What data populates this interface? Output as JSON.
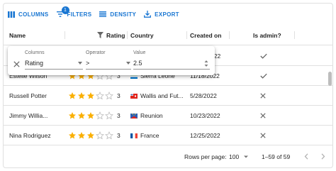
{
  "toolbar": {
    "columns_label": "COLUMNS",
    "filters_label": "FILTERS",
    "filters_badge": "1",
    "density_label": "DENSITY",
    "export_label": "EXPORT"
  },
  "columns": {
    "name": "Name",
    "rating": "Rating",
    "country": "Country",
    "created_on": "Created on",
    "is_admin": "Is admin?"
  },
  "filter": {
    "columns_label": "Columns",
    "columns_value": "Rating",
    "operator_label": "Operator",
    "operator_value": ">",
    "value_label": "Value",
    "value_value": "2.5",
    "partial_date": "022"
  },
  "rows": [
    {
      "name": "Estelle Wilson",
      "rating": 3,
      "rating_label": "3",
      "country": "Sierra Leone",
      "created": "11/18/2022",
      "admin": "false"
    },
    {
      "name": "Russell Potter",
      "rating": 3,
      "rating_label": "3",
      "country": "Wallis and Fut...",
      "created": "5/28/2022",
      "admin": "false"
    },
    {
      "name": "Jimmy Willia...",
      "rating": 3,
      "rating_label": "3",
      "country": "Reunion",
      "created": "10/23/2022",
      "admin": "false"
    },
    {
      "name": "Nina Rodriguez",
      "rating": 3,
      "rating_label": "3",
      "country": "France",
      "created": "12/25/2022",
      "admin": "false"
    }
  ],
  "admin_column_marks": [
    "check",
    "check",
    "close",
    "close",
    "close"
  ],
  "footer": {
    "rows_per_page_label": "Rows per page:",
    "rows_per_page_value": "100",
    "range": "1–59 of 59"
  },
  "colors": {
    "primary": "#1976d2",
    "star_filled": "#faaf00",
    "star_empty": "#bdbdbd",
    "border": "#e0e0e0"
  }
}
